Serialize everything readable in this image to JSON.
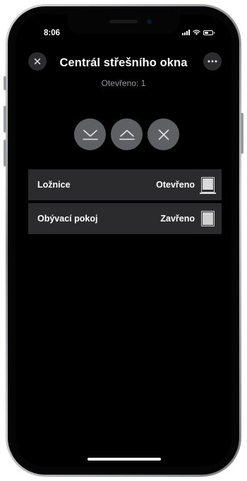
{
  "status_bar": {
    "time": "8:06",
    "icons": [
      "signal-icon",
      "wifi-icon",
      "battery-icon"
    ]
  },
  "header": {
    "title": "Centrál střešního okna",
    "subtitle": "Otevřeno: 1",
    "close_icon": "close-icon",
    "more_icon": "more-icon"
  },
  "controls": [
    {
      "name": "open-all-button",
      "icon": "chevron-down-bar-icon"
    },
    {
      "name": "close-all-button",
      "icon": "chevron-up-bar-icon"
    },
    {
      "name": "stop-button",
      "icon": "x-icon"
    }
  ],
  "rooms": [
    {
      "name": "Ložnice",
      "state": "Otevřeno",
      "icon": "window-open-icon"
    },
    {
      "name": "Obývací pokoj",
      "state": "Zavřeno",
      "icon": "window-closed-icon"
    }
  ],
  "colors": {
    "background": "#000000",
    "row_background": "#2b2b2e",
    "control_background": "#5f6064",
    "subtitle": "#9a9aa0"
  }
}
